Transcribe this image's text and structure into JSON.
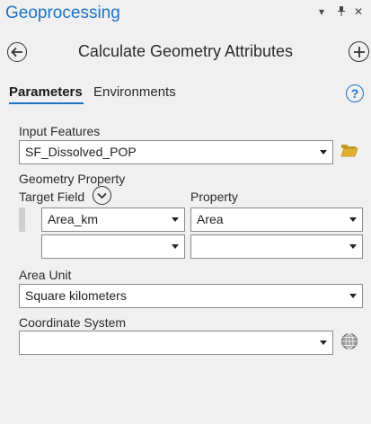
{
  "pane": {
    "title": "Geoprocessing",
    "menu_glyph": "▾",
    "pin_glyph": "⊥",
    "close_glyph": "✕"
  },
  "tool": {
    "title": "Calculate Geometry Attributes"
  },
  "tabs": {
    "parameters": "Parameters",
    "environments": "Environments",
    "help_glyph": "?"
  },
  "input_features": {
    "label": "Input Features",
    "value": "SF_Dissolved_POP"
  },
  "geometry_property": {
    "label": "Geometry Property",
    "target_field_header": "Target Field",
    "property_header": "Property",
    "rows": [
      {
        "target_field": "Area_km",
        "property": "Area"
      },
      {
        "target_field": "",
        "property": ""
      }
    ]
  },
  "area_unit": {
    "label": "Area Unit",
    "value": "Square kilometers"
  },
  "coordinate_system": {
    "label": "Coordinate System",
    "value": ""
  },
  "colors": {
    "accent": "#1b73c9",
    "folder": "#e0b12f",
    "background": "#f0f0f0"
  },
  "icons": {
    "back": "back-arrow-icon",
    "add": "add-icon",
    "help": "help-icon",
    "folder": "folder-icon",
    "expand": "chevron-down-icon",
    "globe": "globe-icon"
  }
}
